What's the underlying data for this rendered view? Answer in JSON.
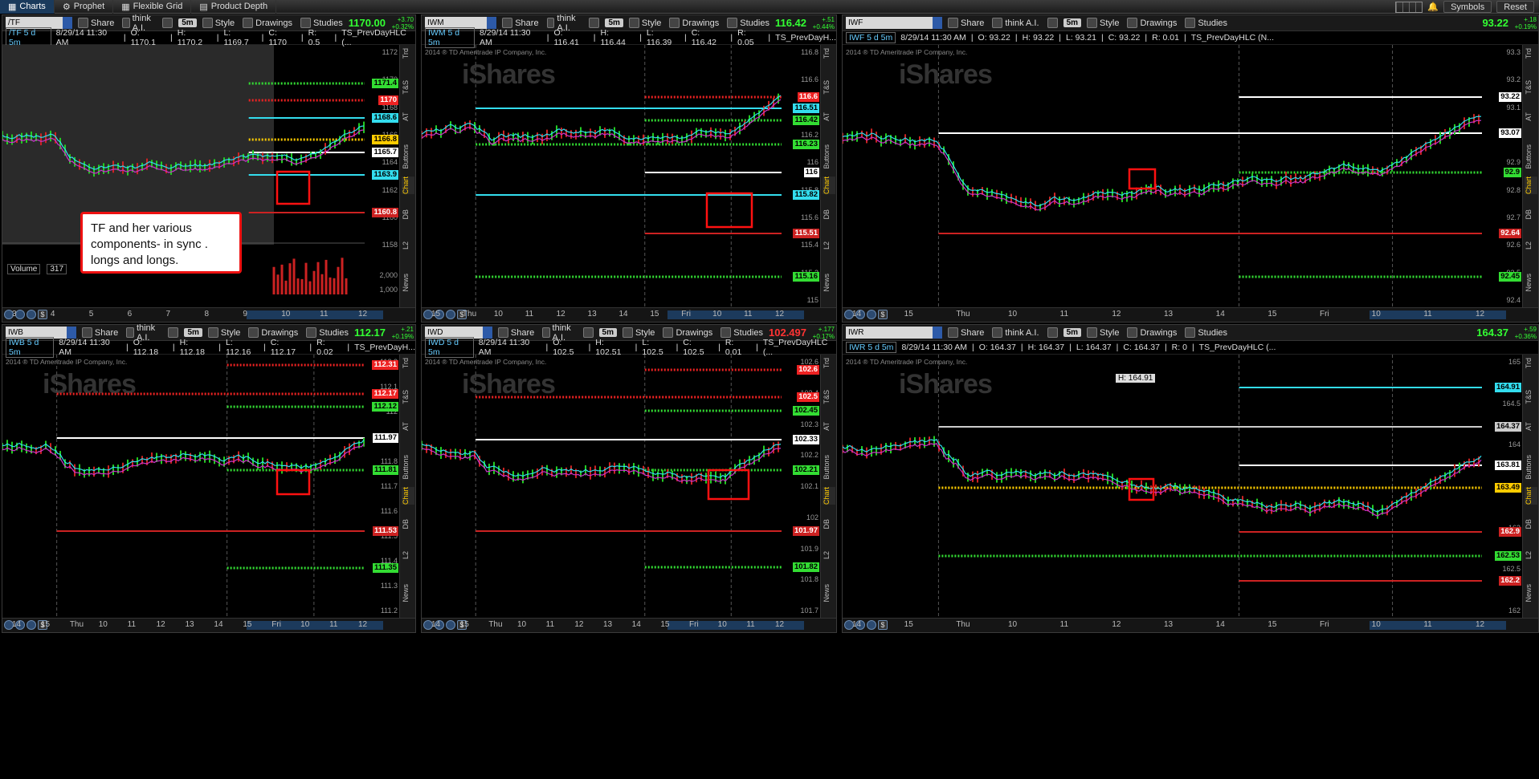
{
  "topbar": {
    "tabs": [
      "Charts",
      "Prophet",
      "Flexible Grid",
      "Product Depth"
    ],
    "right": [
      "Symbols",
      "Reset"
    ]
  },
  "header_buttons": {
    "share": "Share",
    "think": "think A.I.",
    "style": "Style",
    "drawings": "Drawings",
    "studies": "Studies"
  },
  "side_tabs": [
    "Trd",
    "T&S",
    "AT",
    "Buttons",
    "Chart",
    "DB",
    "L2",
    "News"
  ],
  "annotation": {
    "line1": "TF and her various",
    "line2": "components- in sync .",
    "line3": "longs and longs."
  },
  "copyright": "2014 ® TD Ameritrade IP Company, Inc.",
  "watermark": "iShares",
  "panels": [
    {
      "symbol": "/TF",
      "agg": "5m",
      "last": "1170.00",
      "chg1": "+3.70",
      "chg2": "+0.32%",
      "last_color": "#33ff33",
      "desc": "/TF 5 d 5m",
      "date": "8/29/14 11:30 AM",
      "o": "O: 1170.1",
      "h": "H: 1170.2",
      "l": "L: 1169.7",
      "c": "C: 1170",
      "r": "R: 0.5",
      "study": "TS_PrevDayHLC (...",
      "ticks": [
        "1172",
        "1170",
        "1168",
        "1166",
        "1164",
        "1162",
        "1160",
        "1158",
        "2,000",
        "1,000"
      ],
      "labels": [
        {
          "t": "1171.4",
          "c": "#33dd33"
        },
        {
          "t": "1170",
          "c": "#ee2222"
        },
        {
          "t": "1168.6",
          "c": "#33ddee"
        },
        {
          "t": "1166.8",
          "c": "#ffcc00"
        },
        {
          "t": "1165.7",
          "c": "#ffffff"
        },
        {
          "t": "1163.9",
          "c": "#33ddee"
        },
        {
          "t": "1160.8",
          "c": "#cc2222"
        }
      ],
      "volume": {
        "label": "Volume",
        "value": "317"
      },
      "x": [
        "3",
        "4",
        "5",
        "6",
        "7",
        "8",
        "9",
        "10",
        "11",
        "12"
      ]
    },
    {
      "symbol": "IWM",
      "agg": "5m",
      "last": "116.42",
      "chg1": "+.51",
      "chg2": "+0.44%",
      "last_color": "#33ff33",
      "desc": "IWM 5 d 5m",
      "date": "8/29/14 11:30 AM",
      "o": "O: 116.41",
      "h": "H: 116.44",
      "l": "L: 116.39",
      "c": "C: 116.42",
      "r": "R: 0.05",
      "study": "TS_PrevDayH...",
      "ticks": [
        "116.8",
        "116.6",
        "116.4",
        "116.2",
        "116",
        "115.8",
        "115.6",
        "115.4",
        "115.2",
        "115"
      ],
      "labels": [
        {
          "t": "116.6",
          "c": "#ee2222"
        },
        {
          "t": "116.51",
          "c": "#33ddee"
        },
        {
          "t": "116.42",
          "c": "#33dd33"
        },
        {
          "t": "116.23",
          "c": "#33dd33"
        },
        {
          "t": "116",
          "c": "#ffffff"
        },
        {
          "t": "115.82",
          "c": "#33ddee"
        },
        {
          "t": "115.51",
          "c": "#cc2222"
        },
        {
          "t": "115.16",
          "c": "#33dd33"
        }
      ],
      "x": [
        "15",
        "Thu",
        "10",
        "11",
        "12",
        "13",
        "14",
        "15",
        "Fri",
        "10",
        "11",
        "12"
      ]
    },
    {
      "symbol": "IWF",
      "agg": "5m",
      "last": "93.22",
      "chg1": "+.18",
      "chg2": "+0.19%",
      "last_color": "#33ff33",
      "desc": "IWF 5 d 5m",
      "date": "8/29/14 11:30 AM",
      "o": "O: 93.22",
      "h": "H: 93.22",
      "l": "L: 93.21",
      "c": "C: 93.22",
      "r": "R: 0.01",
      "study": "TS_PrevDayHLC (N...",
      "ticks": [
        "93.3",
        "93.2",
        "93.1",
        "93",
        "92.9",
        "92.8",
        "92.7",
        "92.6",
        "92.5",
        "92.4"
      ],
      "labels": [
        {
          "t": "93.22",
          "c": "#ffffff"
        },
        {
          "t": "93.07",
          "c": "#ffffff"
        },
        {
          "t": "92.9",
          "c": "#33dd33"
        },
        {
          "t": "92.64",
          "c": "#cc2222"
        },
        {
          "t": "92.45",
          "c": "#33dd33"
        }
      ],
      "x": [
        "14",
        "15",
        "Thu",
        "10",
        "11",
        "12",
        "13",
        "14",
        "15",
        "Fri",
        "10",
        "11",
        "12"
      ]
    },
    {
      "symbol": "IWB",
      "agg": "5m",
      "last": "112.17",
      "chg1": "+.21",
      "chg2": "+0.19%",
      "last_color": "#33ff33",
      "desc": "IWB 5 d 5m",
      "date": "8/29/14 11:30 AM",
      "o": "O: 112.18",
      "h": "H: 112.18",
      "l": "L: 112.16",
      "c": "C: 112.17",
      "r": "R: 0.02",
      "study": "TS_PrevDayH...",
      "ticks": [
        "112.3",
        "112.1",
        "112",
        "111.9",
        "111.8",
        "111.7",
        "111.6",
        "111.5",
        "111.4",
        "111.3",
        "111.2"
      ],
      "labels": [
        {
          "t": "112.31",
          "c": "#ee2222"
        },
        {
          "t": "112.17",
          "c": "#ee2222"
        },
        {
          "t": "112.12",
          "c": "#33dd33"
        },
        {
          "t": "111.97",
          "c": "#ffffff"
        },
        {
          "t": "111.81",
          "c": "#33dd33"
        },
        {
          "t": "111.53",
          "c": "#cc2222"
        },
        {
          "t": "111.35",
          "c": "#33dd33"
        }
      ],
      "x": [
        "14",
        "15",
        "Thu",
        "10",
        "11",
        "12",
        "13",
        "14",
        "15",
        "Fri",
        "10",
        "11",
        "12"
      ]
    },
    {
      "symbol": "IWD",
      "agg": "5m",
      "last": "102.497",
      "chg1": "+.177",
      "chg2": "+0.17%",
      "last_color": "#ff3333",
      "desc": "IWD 5 d 5m",
      "date": "8/29/14 11:30 AM",
      "o": "O: 102.5",
      "h": "H: 102.51",
      "l": "L: 102.5",
      "c": "C: 102.5",
      "r": "R: 0.01",
      "study": "TS_PrevDayHLC (...",
      "ticks": [
        "102.6",
        "102.4",
        "102.3",
        "102.2",
        "102.1",
        "102",
        "101.9",
        "101.8",
        "101.7"
      ],
      "labels": [
        {
          "t": "102.6",
          "c": "#ee2222"
        },
        {
          "t": "102.5",
          "c": "#ee2222"
        },
        {
          "t": "102.45",
          "c": "#33dd33"
        },
        {
          "t": "102.33",
          "c": "#ffffff"
        },
        {
          "t": "102.21",
          "c": "#33dd33"
        },
        {
          "t": "101.97",
          "c": "#cc2222"
        },
        {
          "t": "101.82",
          "c": "#33dd33"
        }
      ],
      "x": [
        "14",
        "15",
        "Thu",
        "10",
        "11",
        "12",
        "13",
        "14",
        "15",
        "Fri",
        "10",
        "11",
        "12"
      ]
    },
    {
      "symbol": "IWR",
      "agg": "5m",
      "last": "164.37",
      "chg1": "+.59",
      "chg2": "+0.36%",
      "last_color": "#33ff33",
      "desc": "IWR 5 d 5m",
      "date": "8/29/14 11:30 AM",
      "o": "O: 164.37",
      "h": "H: 164.37",
      "l": "L: 164.37",
      "c": "C: 164.37",
      "r": "R: 0",
      "study": "TS_PrevDayHLC (...",
      "hi_label": "H: 164.91",
      "ticks": [
        "165",
        "164.5",
        "164",
        "163.5",
        "163",
        "162.5",
        "162"
      ],
      "labels": [
        {
          "t": "164.91",
          "c": "#33ddee"
        },
        {
          "t": "164.37",
          "c": "#cccccc"
        },
        {
          "t": "163.81",
          "c": "#ffffff"
        },
        {
          "t": "163.49",
          "c": "#ffcc00"
        },
        {
          "t": "162.9",
          "c": "#cc2222"
        },
        {
          "t": "162.53",
          "c": "#33dd33"
        },
        {
          "t": "162.2",
          "c": "#cc2222"
        }
      ],
      "x": [
        "14",
        "15",
        "Thu",
        "10",
        "11",
        "12",
        "13",
        "14",
        "15",
        "Fri",
        "10",
        "11",
        "12"
      ]
    }
  ]
}
